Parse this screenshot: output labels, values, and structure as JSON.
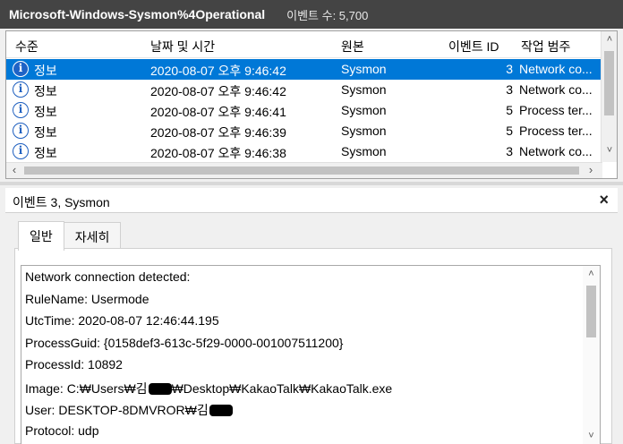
{
  "window": {
    "log_name": "Microsoft-Windows-Sysmon%4Operational",
    "event_count_label": "이벤트 수: 5,700"
  },
  "list": {
    "columns": [
      "수준",
      "날짜 및 시간",
      "원본",
      "이벤트 ID",
      "작업 범주"
    ],
    "rows": [
      {
        "level": "정보",
        "date": "2020-08-07 오후 9:46:42",
        "source": "Sysmon",
        "event_id": "3",
        "category": "Network co...",
        "selected": true
      },
      {
        "level": "정보",
        "date": "2020-08-07 오후 9:46:42",
        "source": "Sysmon",
        "event_id": "3",
        "category": "Network co...",
        "selected": false
      },
      {
        "level": "정보",
        "date": "2020-08-07 오후 9:46:41",
        "source": "Sysmon",
        "event_id": "5",
        "category": "Process ter...",
        "selected": false
      },
      {
        "level": "정보",
        "date": "2020-08-07 오후 9:46:39",
        "source": "Sysmon",
        "event_id": "5",
        "category": "Process ter...",
        "selected": false
      },
      {
        "level": "정보",
        "date": "2020-08-07 오후 9:46:38",
        "source": "Sysmon",
        "event_id": "3",
        "category": "Network co...",
        "selected": false
      }
    ]
  },
  "detail": {
    "title": "이벤트 3, Sysmon",
    "close_icon": "×",
    "tabs": [
      "일반",
      "자세히"
    ],
    "active_tab": "일반",
    "lines": [
      "Network connection detected:",
      "RuleName: Usermode",
      "UtcTime: 2020-08-07 12:46:44.195",
      "ProcessGuid: {0158def3-613c-5f29-0000-001007511200}",
      "ProcessId: 10892"
    ],
    "image_line": {
      "before": "Image: C:₩Users₩김",
      "after": "₩Desktop₩KakaoTalk₩KakaoTalk.exe"
    },
    "user_line": {
      "before": "User: DESKTOP-8DMVROR₩김"
    },
    "protocol_line": "Protocol: udp"
  },
  "colors": {
    "titlebar": "#444444",
    "selection": "#0078d7",
    "info_icon": "#1e5fbf"
  },
  "icons": {
    "row_level": "info-icon",
    "scroll_up": "chevron-up-icon",
    "scroll_down": "chevron-down-icon",
    "scroll_left": "chevron-left-icon",
    "scroll_right": "chevron-right-icon"
  }
}
